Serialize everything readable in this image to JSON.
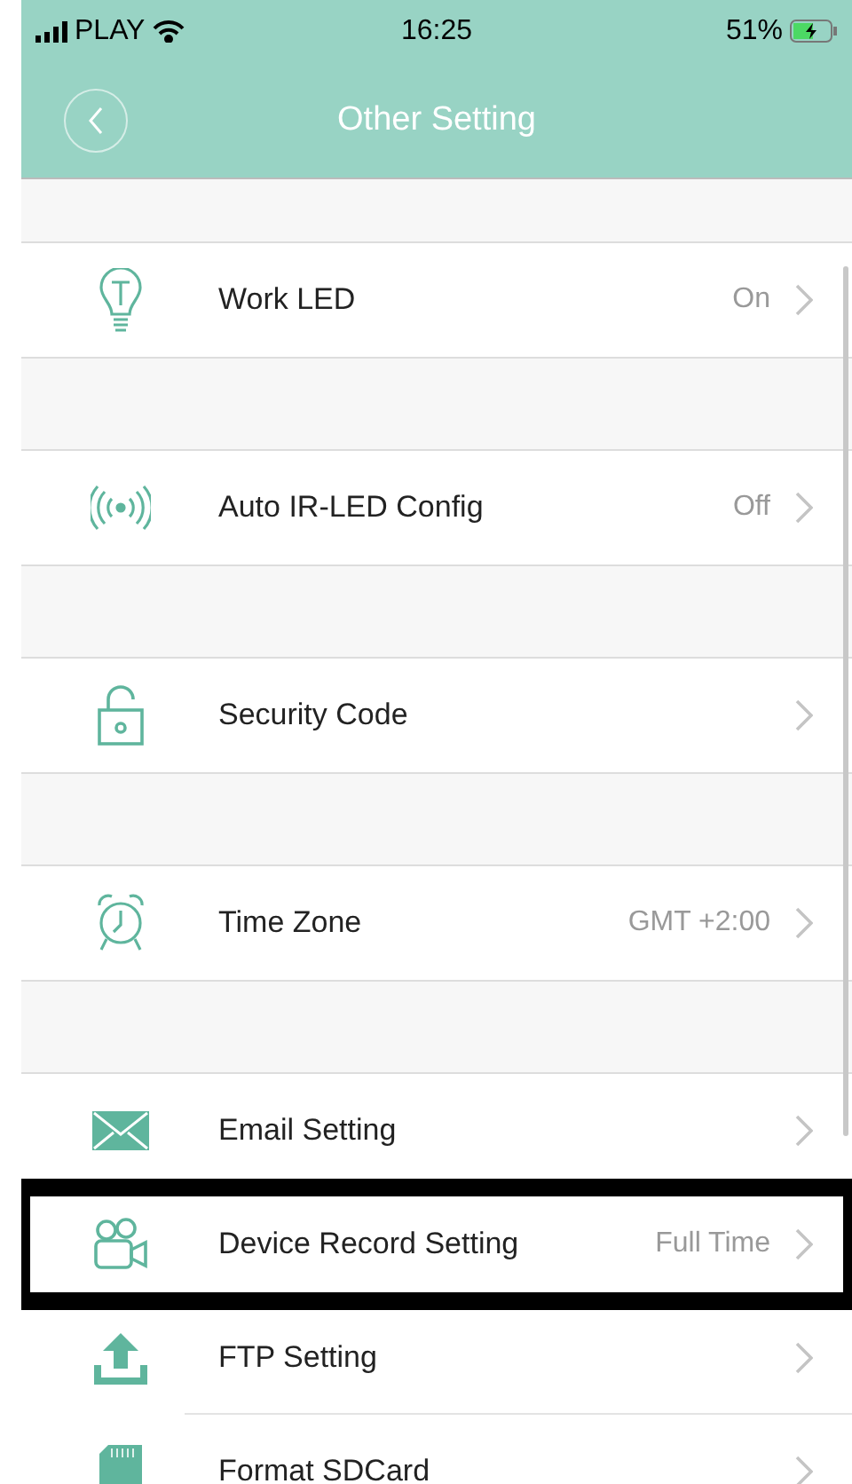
{
  "status_bar": {
    "carrier": "PLAY",
    "time": "16:25",
    "battery": "51%"
  },
  "header": {
    "title": "Other Setting"
  },
  "sections": [
    {
      "rows": [
        {
          "label": "Work LED",
          "value": "On",
          "highlighted": false
        }
      ]
    },
    {
      "rows": [
        {
          "label": "Auto IR-LED Config",
          "value": "Off",
          "highlighted": false
        }
      ]
    },
    {
      "rows": [
        {
          "label": "Security Code",
          "highlighted": false
        }
      ]
    },
    {
      "rows": [
        {
          "label": "Time Zone",
          "value": "GMT +2:00",
          "highlighted": false
        }
      ]
    },
    {
      "rows": [
        {
          "label": "Email Setting",
          "highlighted": false
        },
        {
          "label": "Device Record Setting",
          "value": "Full Time",
          "highlighted": true
        },
        {
          "label": "FTP Setting",
          "highlighted": false
        },
        {
          "label": "Format SDCard",
          "highlighted": false
        }
      ]
    }
  ]
}
